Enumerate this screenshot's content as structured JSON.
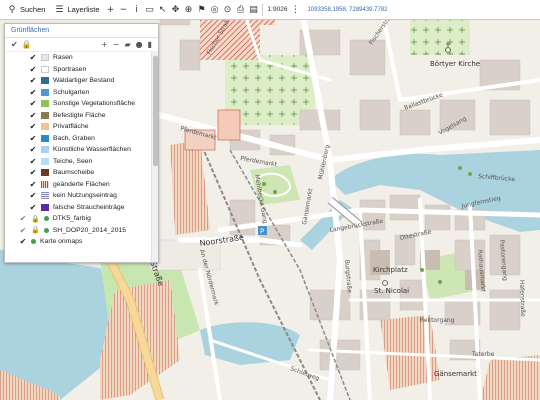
{
  "toolbar": {
    "search_label": "Suchen",
    "layerlist_label": "Layerliste",
    "scale": "1:9026",
    "coordinates": "1093358.1958, 7289439.7782"
  },
  "panel": {
    "title": "Grünflächen",
    "layers": [
      {
        "label": "Rasen",
        "swatch": "#e7e7e7",
        "check": "✔"
      },
      {
        "label": "Sportrasen",
        "swatch": "#ffffff",
        "check": "✔"
      },
      {
        "label": "Waldartiger Bestand",
        "swatch": "#2e6e8e",
        "check": "✔"
      },
      {
        "label": "Schulgarten",
        "swatch": "#4a9ad0",
        "check": "✔"
      },
      {
        "label": "Sonstige Vegetationsfläche",
        "swatch": "#8fc05a",
        "check": "✔"
      },
      {
        "label": "Befestigte Fläche",
        "swatch": "#8a7b52",
        "check": "✔"
      },
      {
        "label": "Privatfläche",
        "swatch": "#f2c38a",
        "check": "✔"
      },
      {
        "label": "Bach, Graben",
        "swatch": "#1e90c8",
        "check": "✔"
      },
      {
        "label": "Künstliche Wasserflächen",
        "swatch": "#a9d2ee",
        "check": "✔"
      },
      {
        "label": "Teiche, Seen",
        "swatch": "#b8dcf2",
        "check": "✔"
      },
      {
        "label": "Baumscheibe",
        "swatch": "#6b3a2a",
        "check": "✔"
      },
      {
        "label": "geänderte Flächen",
        "swatch": "#d23c3c",
        "check": "✔"
      },
      {
        "label": "kein Nutzungseintrag",
        "swatch": "#d0d0e8",
        "check": "✔"
      },
      {
        "label": "falsche Straucheinträge",
        "swatch": "#5a2aa0",
        "check": "✔"
      }
    ],
    "base_layers": [
      {
        "label": "DTK5_farbig",
        "check": "✔",
        "gray": true
      },
      {
        "label": "SH_DOP20_2014_2015",
        "check": "✔",
        "gray": true
      },
      {
        "label": "Karte onmaps",
        "check": "✔",
        "gray": false
      }
    ]
  },
  "map": {
    "labels": {
      "fischerstrasse_top": "Fischer Straße",
      "fischerstrasse_mid": "Fischerstraße",
      "boerdener_kirche": "Börtyer Kirche",
      "pferdemarkt": "Pferdemarkt",
      "muehlenberg": "Mühlenberg",
      "gaensemarkt": "Gänsemarkt",
      "noorstrasse": "Noorstraße",
      "am_der_noerdermark": "An der Nördermark",
      "schiffbruecke": "Schiffbrücke",
      "jungfernstieg": "Jungfernstieg",
      "kirchplatz": "Kirchplatz",
      "st_nicolai": "St. Nicolai",
      "rektorgang": "Rektorgang",
      "gaensemarkt2": "Gänsemarkt",
      "schleiweg": "Schleiweg",
      "langebruecke": "Langebrückstraße",
      "vogelsang": "Vogelsang",
      "strasse_left": "Straße",
      "ballastbruecke": "Ballastbrücke",
      "burgstrasse": "Burgstraße",
      "ottestrasse": "Ottestraße",
      "rathausmarkt": "Rathausmarkt",
      "pastorengang": "Pastorengang",
      "taterbe": "Taterbe",
      "hafenstrasse": "Hafenstraße",
      "mehlbeck": "Mehlbecks Gang"
    },
    "colors": {
      "water": "#aad3df",
      "land": "#f2efe9",
      "building": "#d9d0c9",
      "green": "#c8e6b0",
      "street": "#ffffff",
      "major_road": "#f7d89a",
      "hatch_red": "#c0392b"
    }
  }
}
